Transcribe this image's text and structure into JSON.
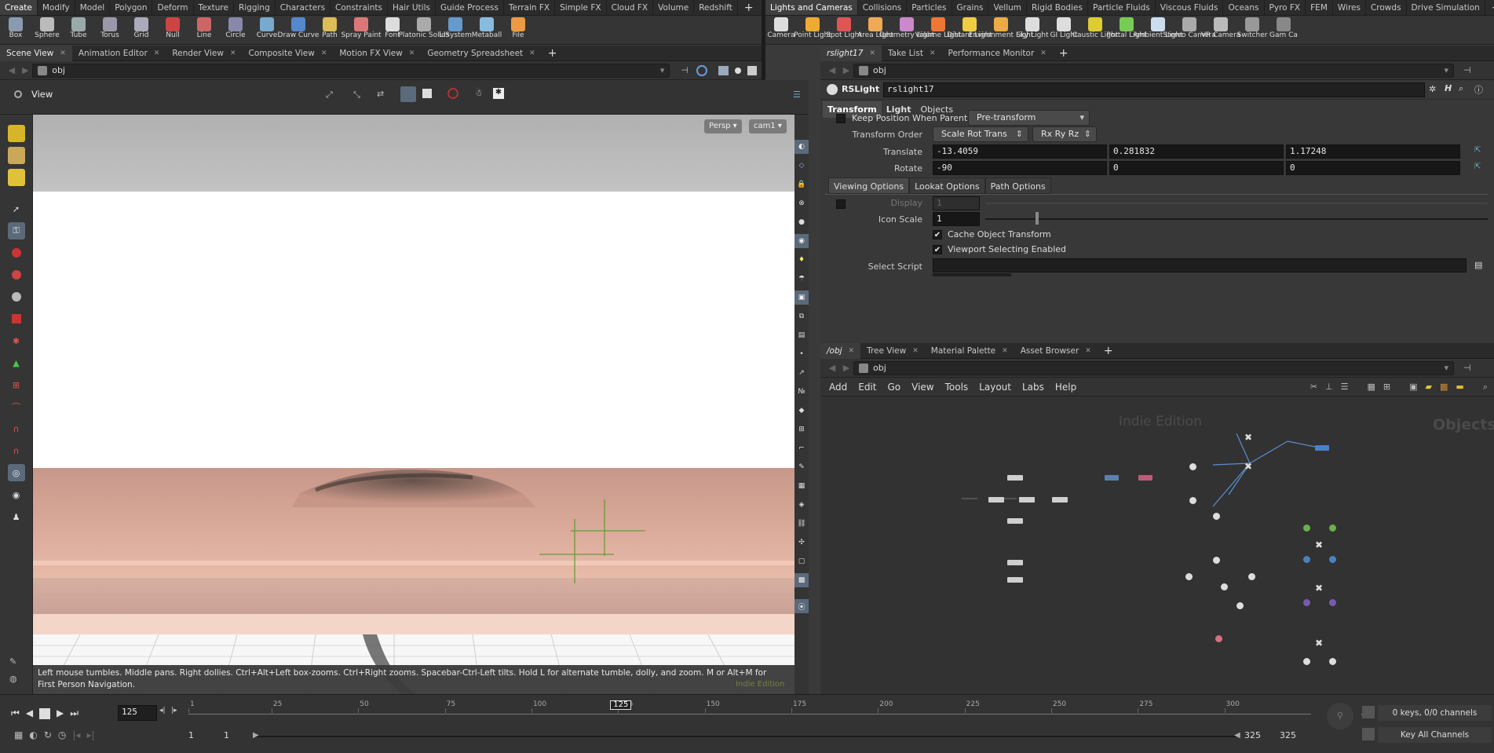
{
  "shelf_left": {
    "tabs": [
      "Create",
      "Modify",
      "Model",
      "Polygon",
      "Deform",
      "Texture",
      "Rigging",
      "Characters",
      "Constraints",
      "Hair Utils",
      "Guide Process",
      "Terrain FX",
      "Simple FX",
      "Cloud FX",
      "Volume",
      "Redshift"
    ],
    "tools": [
      "Box",
      "Sphere",
      "Tube",
      "Torus",
      "Grid",
      "Null",
      "Line",
      "Circle",
      "Curve",
      "Draw Curve",
      "Path",
      "Spray Paint",
      "Font",
      "Platonic Solids",
      "L-System",
      "Metaball",
      "File"
    ]
  },
  "shelf_right": {
    "tabs": [
      "Lights and Cameras",
      "Collisions",
      "Particles",
      "Grains",
      "Vellum",
      "Rigid Bodies",
      "Particle Fluids",
      "Viscous Fluids",
      "Oceans",
      "Pyro FX",
      "FEM",
      "Wires",
      "Crowds",
      "Drive Simulation"
    ],
    "tools": [
      "Camera",
      "Point Light",
      "Spot Light",
      "Area Light",
      "Geometry Light",
      "Volume Light",
      "Distant Light",
      "Environment Light",
      "Sky Light",
      "GI Light",
      "Caustic Light",
      "Portal Light",
      "Ambient Light",
      "Stereo Camera",
      "VR Camera",
      "Switcher",
      "Gam Ca"
    ]
  },
  "left_pane": {
    "tabs": [
      "Scene View",
      "Animation Editor",
      "Render View",
      "Composite View",
      "Motion FX View",
      "Geometry Spreadsheet"
    ],
    "path": "obj",
    "view_label": "View",
    "persp_label": "Persp ▾",
    "cam_label": "cam1 ▾",
    "hint_text": "Left mouse tumbles. Middle pans. Right dollies. Ctrl+Alt+Left box-zooms. Ctrl+Right zooms. Spacebar-Ctrl-Left tilts. Hold L for alternate tumble, dolly, and zoom.     M or Alt+M for First Person Navigation.",
    "watermark": "Indie Edition"
  },
  "params_pane": {
    "tabs": [
      "rslight17",
      "Take List",
      "Performance Monitor"
    ],
    "path": "obj",
    "node_type": "RSLight",
    "node_name": "rslight17",
    "subtabs": [
      "Transform",
      "Light",
      "Objects"
    ],
    "keep_position_label": "Keep Position When Parenting",
    "keep_position_value": "Pre-transform",
    "transform_order_label": "Transform Order",
    "transform_order_value": "Scale Rot Trans",
    "rot_order_value": "Rx Ry Rz",
    "translate_label": "Translate",
    "translate": [
      "-13.4059",
      "0.281832",
      "1.17248"
    ],
    "rotate_label": "Rotate",
    "rotate": [
      "-90",
      "0",
      "0"
    ],
    "option_tabs": [
      "Viewing Options",
      "Lookat Options",
      "Path Options"
    ],
    "display_label": "Display",
    "display_value": "1",
    "icon_scale_label": "Icon Scale",
    "icon_scale_value": "1",
    "icon_scale_fraction": 0.1,
    "cache_label": "Cache Object Transform",
    "viewport_select_label": "Viewport Selecting Enabled",
    "select_script_label": "Select Script"
  },
  "network_pane": {
    "tabs": [
      "/obj",
      "Tree View",
      "Material Palette",
      "Asset Browser"
    ],
    "path": "obj",
    "menu": [
      "Add",
      "Edit",
      "Go",
      "View",
      "Tools",
      "Layout",
      "Labs",
      "Help"
    ],
    "watermark": "Indie Edition",
    "context_label": "Objects"
  },
  "timeline": {
    "current_frame": "125",
    "ticks": [
      "1",
      "25",
      "50",
      "75",
      "100",
      "125",
      "150",
      "175",
      "200",
      "225",
      "250",
      "275",
      "300"
    ],
    "range_start": "1",
    "range_start2": "1",
    "range_end": "325",
    "range_end2": "325",
    "keys_status": "0 keys, 0/0 channels",
    "key_all_label": "Key All Channels"
  }
}
